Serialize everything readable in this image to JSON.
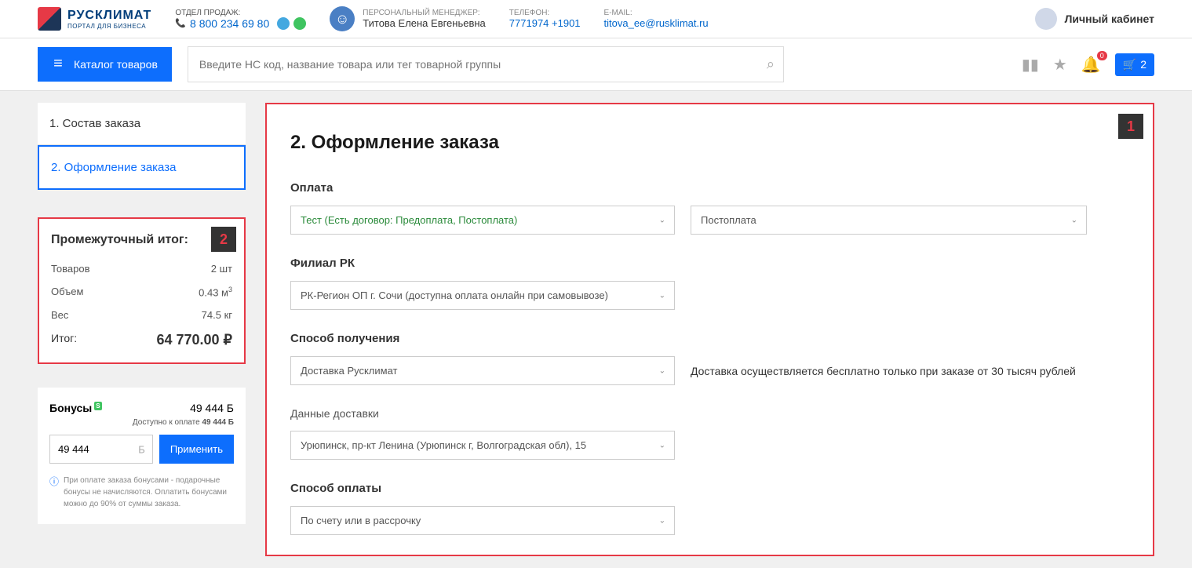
{
  "header": {
    "logo_title": "РУСКЛИМАТ",
    "logo_subtitle": "ПОРТАЛ ДЛЯ БИЗНЕСА",
    "sales_label": "ОТДЕЛ ПРОДАЖ:",
    "phone": "8 800 234 69 80",
    "manager_label": "ПЕРСОНАЛЬНЫЙ МЕНЕДЖЕР:",
    "manager_name": "Титова Елена Евгеньевна",
    "phone_label": "ТЕЛЕФОН:",
    "manager_phone": "7771974 +1901",
    "email_label": "E-MAIL:",
    "manager_email": "titova_ee@rusklimat.ru",
    "account_label": "Личный кабинет"
  },
  "nav": {
    "catalog_label": "Каталог товаров",
    "search_placeholder": "Введите НС код, название товара или тег товарной группы",
    "notif_badge": "0",
    "cart_count": "2"
  },
  "steps": {
    "step1": "1. Состав заказа",
    "step2": "2. Оформление заказа"
  },
  "summary": {
    "title": "Промежуточный итог:",
    "items_label": "Товаров",
    "items_value": "2 шт",
    "volume_label": "Объем",
    "volume_value": "0.43 м",
    "volume_unit": "3",
    "weight_label": "Вес",
    "weight_value": "74.5 кг",
    "total_label": "Итог:",
    "total_value": "64 770.00 ₽"
  },
  "bonus": {
    "title": "Бонусы",
    "amount": "49 444 Б",
    "available_prefix": "Доступно к оплате ",
    "available_value": "49 444 Б",
    "input_value": "49 444",
    "input_unit": "Б",
    "apply_label": "Применить",
    "note": "При оплате заказа бонусами - подарочные бонусы не начисляются. Оплатить бонусами можно до 90% от суммы заказа."
  },
  "form": {
    "title": "2. Оформление заказа",
    "payment_label": "Оплата",
    "payment_select1": "Тест (Есть договор: Предоплата, Постоплата)",
    "payment_select2": "Постоплата",
    "branch_label": "Филиал РК",
    "branch_select": "РК-Регион ОП г. Сочи (доступна оплата онлайн при самовывозе)",
    "delivery_label": "Способ получения",
    "delivery_select": "Доставка Русклимат",
    "delivery_note": "Доставка осуществляется бесплатно только при заказе от 30 тысяч рублей",
    "delivery_data_label": "Данные доставки",
    "delivery_address": "Урюпинск, пр-кт Ленина (Урюпинск г, Волгоградская обл), 15",
    "payment_method_label": "Способ оплаты",
    "payment_method_select": "По счету или в рассрочку"
  },
  "annotations": {
    "a1": "1",
    "a2": "2"
  }
}
